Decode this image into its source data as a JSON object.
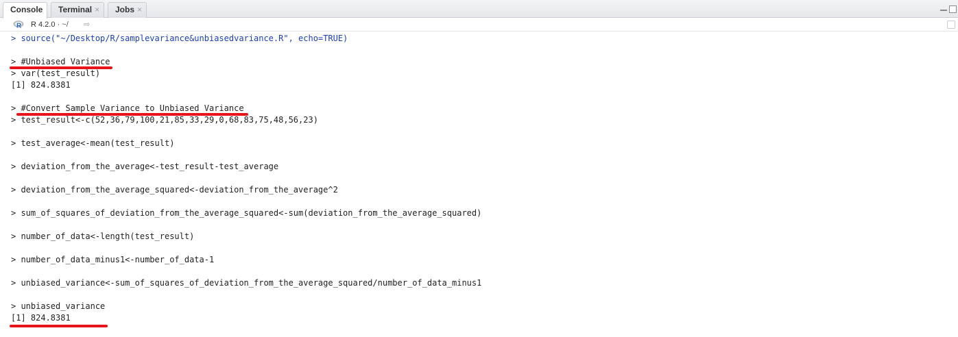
{
  "tabs": [
    {
      "label": "Console",
      "active": true,
      "closable": false
    },
    {
      "label": "Terminal",
      "active": false,
      "closable": true
    },
    {
      "label": "Jobs",
      "active": false,
      "closable": true
    }
  ],
  "close_glyph": "×",
  "toolbar": {
    "r_version": "R 4.2.0",
    "separator": "·",
    "working_dir": "~/",
    "goto_icon": "arrow-right-icon"
  },
  "console_lines": [
    {
      "type": "cmd",
      "text": "> source(\"~/Desktop/R/samplevariance&unbiasedvariance.R\", echo=TRUE)"
    },
    {
      "type": "out",
      "text": "> #Unbiased Variance"
    },
    {
      "type": "out",
      "text": "> var(test_result)"
    },
    {
      "type": "out",
      "text": "[1] 824.8381"
    },
    {
      "type": "out",
      "text": "> #Convert Sample Variance to Unbiased Variance"
    },
    {
      "type": "out",
      "text": "> test_result<-c(52,36,79,100,21,85,33,29,0,68,83,75,48,56,23)"
    },
    {
      "type": "out",
      "text": "> test_average<-mean(test_result)"
    },
    {
      "type": "out",
      "text": "> deviation_from_the_average<-test_result-test_average"
    },
    {
      "type": "out",
      "text": "> deviation_from_the_average_squared<-deviation_from_the_average^2"
    },
    {
      "type": "out",
      "text": "> sum_of_squares_of_deviation_from_the_average_squared<-sum(deviation_from_the_average_squared)"
    },
    {
      "type": "out",
      "text": "> number_of_data<-length(test_result)"
    },
    {
      "type": "out",
      "text": "> number_of_data_minus1<-number_of_data-1"
    },
    {
      "type": "out",
      "text": "> unbiased_variance<-sum_of_squares_of_deviation_from_the_average_squared/number_of_data_minus1"
    },
    {
      "type": "out",
      "text": "> unbiased_variance"
    },
    {
      "type": "out",
      "text": "[1] 824.8381"
    }
  ],
  "colors": {
    "command_text": "#1c3fbf",
    "output_text": "#222222",
    "annotation_underline": "#e8141b"
  }
}
